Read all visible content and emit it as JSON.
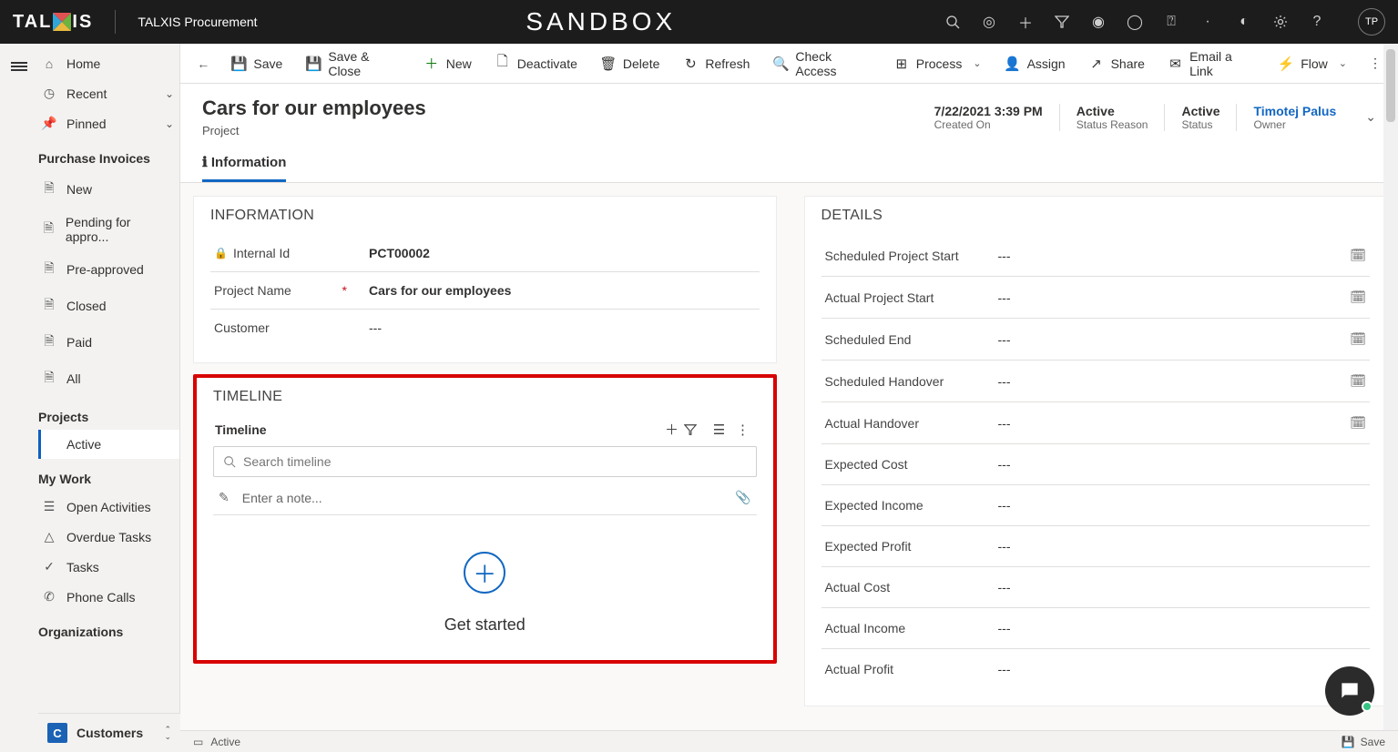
{
  "topbar": {
    "brand_left": "TAL",
    "brand_right": "IS",
    "app_name": "TALXIS Procurement",
    "center_title": "SANDBOX",
    "avatar_initials": "TP"
  },
  "nav": {
    "home": "Home",
    "recent": "Recent",
    "pinned": "Pinned",
    "group_invoices": "Purchase Invoices",
    "new": "New",
    "pending": "Pending for appro...",
    "preapproved": "Pre-approved",
    "closed": "Closed",
    "paid": "Paid",
    "all": "All",
    "group_projects": "Projects",
    "active": "Active",
    "group_mywork": "My Work",
    "open_activities": "Open Activities",
    "overdue": "Overdue Tasks",
    "tasks": "Tasks",
    "phone": "Phone Calls",
    "group_org": "Organizations",
    "app_switcher_badge": "C",
    "app_switcher_text": "Customers"
  },
  "cmd": {
    "save": "Save",
    "save_close": "Save & Close",
    "new": "New",
    "deactivate": "Deactivate",
    "delete": "Delete",
    "refresh": "Refresh",
    "check_access": "Check Access",
    "process": "Process",
    "assign": "Assign",
    "share": "Share",
    "email": "Email a Link",
    "flow": "Flow"
  },
  "record": {
    "title": "Cars for our employees",
    "subtitle": "Project",
    "stats": {
      "created_val": "7/22/2021 3:39 PM",
      "created_lbl": "Created On",
      "sr_val": "Active",
      "sr_lbl": "Status Reason",
      "status_val": "Active",
      "status_lbl": "Status",
      "owner_val": "Timotej Palus",
      "owner_lbl": "Owner"
    }
  },
  "tab": {
    "information": "Information"
  },
  "info_section": {
    "title": "INFORMATION",
    "internal_id_lbl": "Internal Id",
    "internal_id_val": "PCT00002",
    "project_name_lbl": "Project Name",
    "project_name_val": "Cars for our employees",
    "customer_lbl": "Customer",
    "customer_val": "---"
  },
  "timeline": {
    "section_title": "TIMELINE",
    "title": "Timeline",
    "search_placeholder": "Search timeline",
    "note_placeholder": "Enter a note...",
    "get_started": "Get started"
  },
  "details": {
    "title": "DETAILS",
    "sched_start": "Scheduled Project Start",
    "actual_start": "Actual Project Start",
    "sched_end": "Scheduled End",
    "sched_handover": "Scheduled Handover",
    "actual_handover": "Actual Handover",
    "exp_cost": "Expected Cost",
    "exp_income": "Expected Income",
    "exp_profit": "Expected Profit",
    "act_cost": "Actual Cost",
    "act_income": "Actual Income",
    "act_profit": "Actual Profit",
    "dash": "---"
  },
  "statusbar": {
    "active": "Active",
    "save": "Save"
  }
}
